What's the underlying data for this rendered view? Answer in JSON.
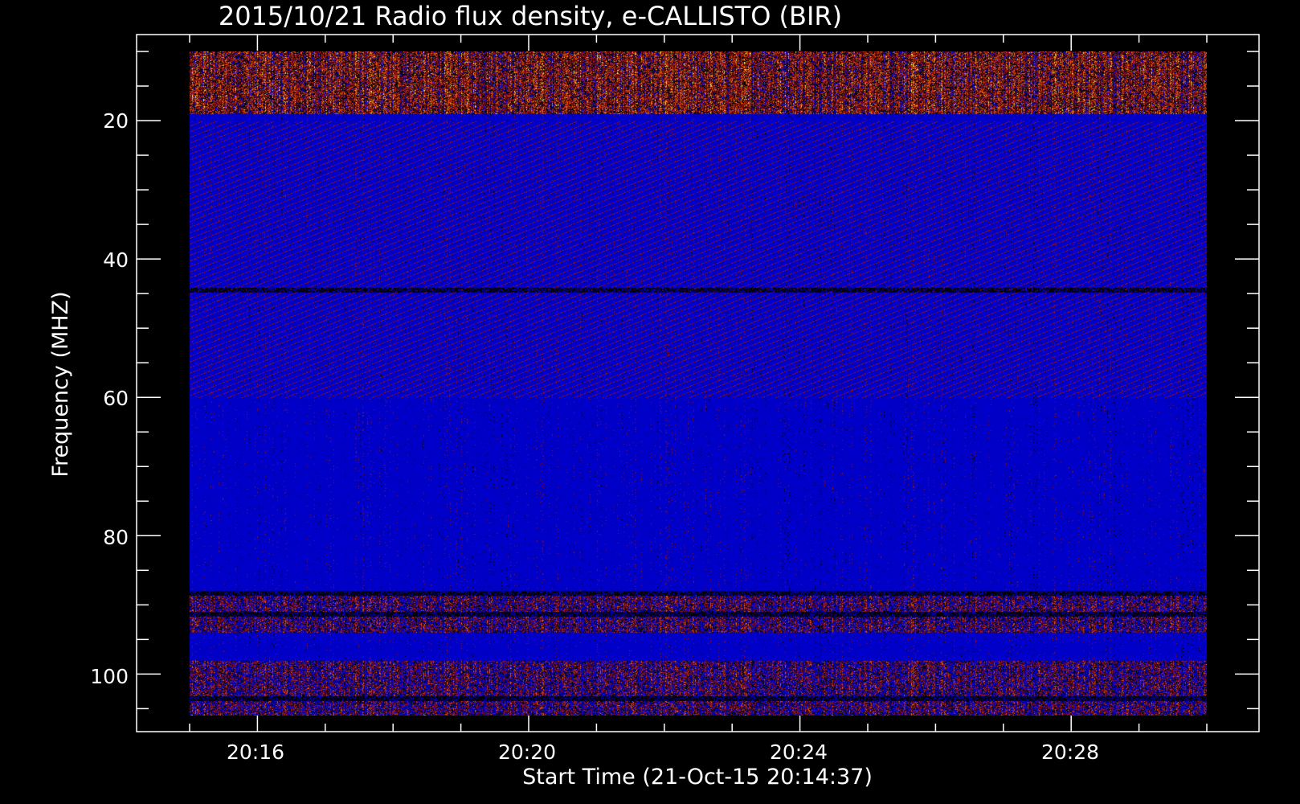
{
  "chart_data": {
    "type": "heatmap",
    "title": "2015/10/21  Radio flux density, e-CALLISTO (BIR)",
    "xlabel": "Start Time (21-Oct-15 20:14:37)",
    "ylabel": "Frequency (MHZ)",
    "x_ticks": [
      "20:16",
      "20:20",
      "20:24",
      "20:28"
    ],
    "x_tick_minutes": [
      16,
      20,
      24,
      28
    ],
    "x_range_minutes": [
      15.0,
      30.0
    ],
    "y_ticks": [
      "20",
      "40",
      "60",
      "80",
      "100"
    ],
    "y_tick_values": [
      20,
      40,
      60,
      80,
      100
    ],
    "y_range": [
      10,
      106
    ],
    "y_reversed": true,
    "colormap": {
      "background": "#0000d8",
      "low": "#000000",
      "mid": "#a01818",
      "high": "#ff6a00",
      "peak": "#ffff66"
    },
    "bright_bands_mhz": [
      [
        10,
        19
      ],
      [
        88,
        94
      ],
      [
        98,
        106
      ]
    ],
    "dark_bands_mhz": [
      44.5,
      88.3,
      91.3,
      103.5
    ]
  }
}
